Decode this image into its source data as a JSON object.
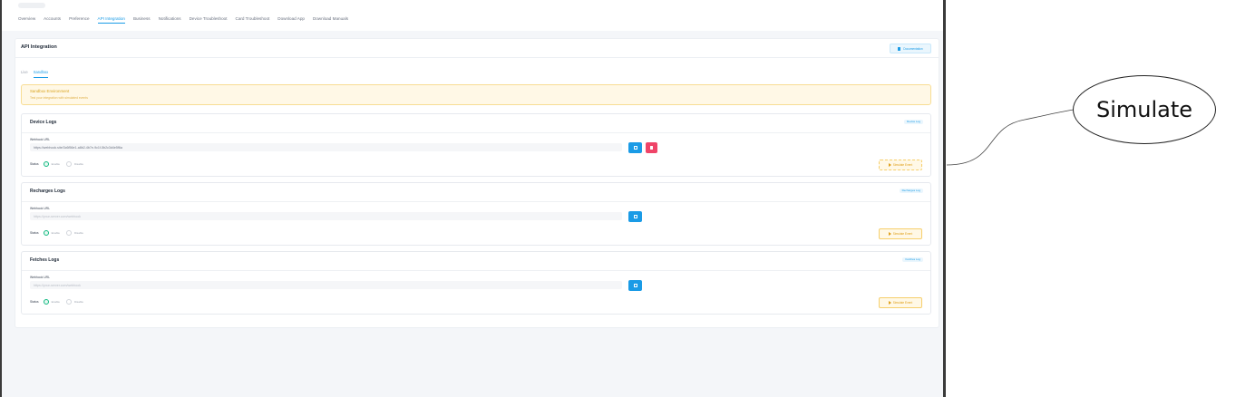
{
  "nav": {
    "tabs": [
      {
        "label": "Overview",
        "active": false
      },
      {
        "label": "Accounts",
        "active": false
      },
      {
        "label": "Preference",
        "active": false
      },
      {
        "label": "API Integration",
        "active": true
      },
      {
        "label": "Business",
        "active": false
      },
      {
        "label": "Notifications",
        "active": false
      },
      {
        "label": "Device Troubleshoot",
        "active": false
      },
      {
        "label": "Card Troubleshoot",
        "active": false
      },
      {
        "label": "Download App",
        "active": false
      },
      {
        "label": "Download Manuals",
        "active": false
      }
    ]
  },
  "page": {
    "title": "API Integration",
    "doc_button": "Documentation"
  },
  "env_tabs": [
    {
      "label": "Live",
      "active": false
    },
    {
      "label": "Sandbox",
      "active": true
    }
  ],
  "banner": {
    "title": "Sandbox Environment",
    "description": "Test your integration with simulated events"
  },
  "log_sections": [
    {
      "title": "Device Logs",
      "badge": "Device Log",
      "webhook_label": "Webhook URL",
      "webhook_value": "https://webhook.site/3c6f56e1-a8b2-4b7e-9c1f-5b2c3d4e5f6a",
      "webhook_placeholder": "",
      "has_delete": true,
      "status_label": "Status",
      "enable_label": "Enable",
      "disable_label": "Disable",
      "enabled": true,
      "simulate_label": "Simulate Event"
    },
    {
      "title": "Recharges Logs",
      "badge": "Recharges Log",
      "webhook_label": "Webhook URL",
      "webhook_value": "",
      "webhook_placeholder": "https://your-server.com/webhook",
      "has_delete": false,
      "status_label": "Status",
      "enable_label": "Enable",
      "disable_label": "Disable",
      "enabled": true,
      "simulate_label": "Simulate Event"
    },
    {
      "title": "Fetches Logs",
      "badge": "Fetches Log",
      "webhook_label": "Webhook URL",
      "webhook_value": "",
      "webhook_placeholder": "https://your-server.com/webhook",
      "has_delete": false,
      "status_label": "Status",
      "enable_label": "Enable",
      "disable_label": "Disable",
      "enabled": true,
      "simulate_label": "Simulate Event"
    }
  ],
  "annotation": {
    "label": "Simulate"
  },
  "colors": {
    "accent": "#1a9be6",
    "danger": "#ef4468",
    "success": "#10b981",
    "warning": "#e0a01a"
  }
}
